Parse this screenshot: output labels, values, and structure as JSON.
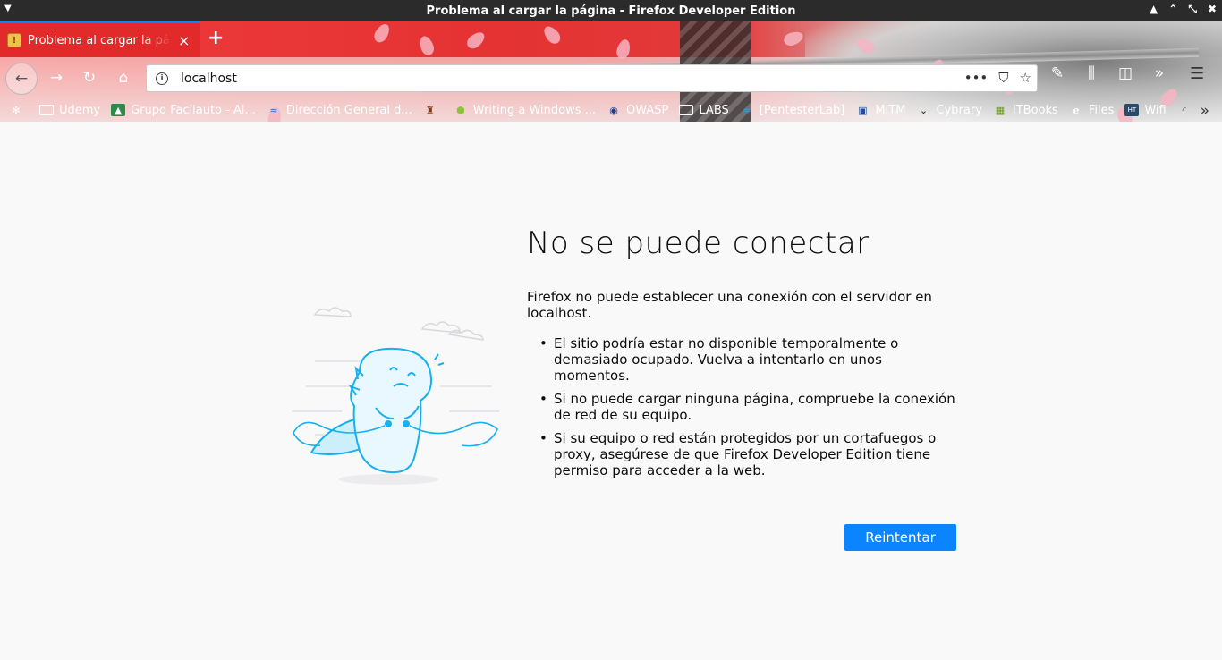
{
  "window": {
    "title": "Problema al cargar la página - Firefox Developer Edition",
    "controls": [
      "▲",
      "⌃",
      "⤡",
      "✖"
    ]
  },
  "tab": {
    "title": "Problema al cargar la página",
    "favicon_glyph": "!",
    "close_glyph": "×"
  },
  "newtab_glyph": "+",
  "nav": {
    "back_glyph": "←",
    "forward_glyph": "→",
    "reload_glyph": "↻",
    "home_glyph": "⌂",
    "url": "localhost",
    "info_glyph": "i",
    "page_actions_glyph": "•••",
    "pocket_glyph": "⛉",
    "star_glyph": "☆"
  },
  "toolbar": {
    "devtools_glyph": "✎",
    "library_glyph": "⫼",
    "sidebar_glyph": "◫",
    "overflow_glyph": "»",
    "menu_glyph": "☰"
  },
  "bookmarks": [
    {
      "label": "",
      "icon": "bug-icon",
      "glyph": "✻"
    },
    {
      "label": "Udemy",
      "icon": "folder-icon"
    },
    {
      "label": "Grupo Facilauto - Al...",
      "icon": "facilauto-icon",
      "glyph": "▲"
    },
    {
      "label": "Dirección General d...",
      "icon": "dgt-icon",
      "glyph": "≈"
    },
    {
      "label": "",
      "icon": "crest-icon",
      "glyph": "♜"
    },
    {
      "label": "Writing a Windows ...",
      "icon": "hex-icon",
      "glyph": "⬢"
    },
    {
      "label": "OWASP",
      "icon": "owasp-icon",
      "glyph": "◉"
    },
    {
      "label": "LABS",
      "icon": "folder-icon"
    },
    {
      "label": "[PentesterLab]",
      "icon": "pentesterlab-icon",
      "glyph": "≈"
    },
    {
      "label": "MITM",
      "icon": "mitm-icon",
      "glyph": "▣"
    },
    {
      "label": "Cybrary",
      "icon": "cybrary-icon",
      "glyph": "⌄"
    },
    {
      "label": "ITBooks",
      "icon": "books-icon",
      "glyph": "▦"
    },
    {
      "label": "Files",
      "icon": "files-icon",
      "glyph": "ℯ"
    },
    {
      "label": "Wifi",
      "icon": "ht-icon",
      "glyph": "HT"
    },
    {
      "label": "",
      "icon": "loading-icon",
      "glyph": "◜"
    }
  ],
  "bookmarks_more_glyph": "»",
  "error": {
    "title": "No se puede conectar",
    "lead": "Firefox no puede establecer una conexión con el servidor en localhost.",
    "bullets": [
      "El sitio podría estar no disponible temporalmente o demasiado ocupado. Vuelva a intentarlo en unos momentos.",
      "Si no puede cargar ninguna página, compruebe la conexión de red de su equipo.",
      "Si su equipo o red están protegidos por un cortafuegos o proxy, asegúrese de que Firefox Developer Edition tiene permiso para acceder a la web."
    ],
    "retry_label": "Reintentar"
  },
  "colors": {
    "accent": "#0a84ff",
    "theme_red": "#e53232",
    "page_bg": "#f9f9fa",
    "illustration_blue": "#17b0f0"
  }
}
